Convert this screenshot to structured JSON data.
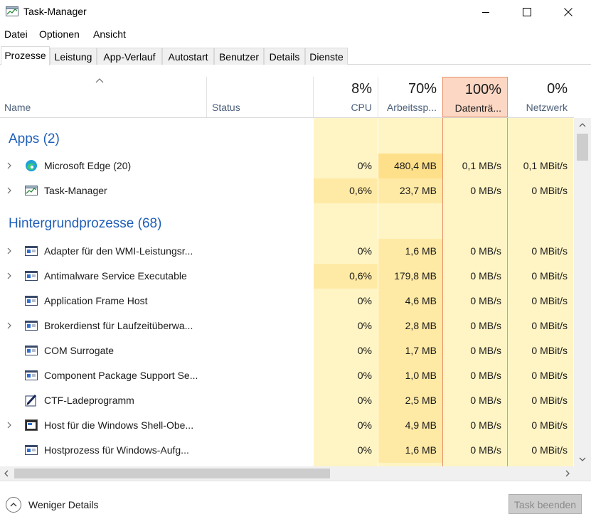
{
  "window": {
    "title": "Task-Manager"
  },
  "menu": [
    "Datei",
    "Optionen",
    "Ansicht"
  ],
  "tabs": [
    "Prozesse",
    "Leistung",
    "App-Verlauf",
    "Autostart",
    "Benutzer",
    "Details",
    "Dienste"
  ],
  "header": {
    "name": "Name",
    "status": "Status",
    "cpu": {
      "pct": "8%",
      "label": "CPU"
    },
    "mem": {
      "pct": "70%",
      "label": "Arbeitssp..."
    },
    "disk": {
      "pct": "100%",
      "label": "Datenträ..."
    },
    "net": {
      "pct": "0%",
      "label": "Netzwerk"
    }
  },
  "groups": {
    "apps": "Apps (2)",
    "bg": "Hintergrundprozesse (68)"
  },
  "apps": [
    {
      "name": "Microsoft Edge (20)",
      "icon": "edge-icon",
      "cpu": "0%",
      "mem": "480,4 MB",
      "disk": "0,1 MB/s",
      "net": "0,1 MBit/s"
    },
    {
      "name": "Task-Manager",
      "icon": "task-manager-icon",
      "cpu": "0,6%",
      "mem": "23,7 MB",
      "disk": "0 MB/s",
      "net": "0 MBit/s"
    }
  ],
  "processes": [
    {
      "name": "Adapter für den WMI-Leistungsr...",
      "expand": true,
      "icon": "process-window-icon",
      "cpu": "0%",
      "mem": "1,6 MB",
      "disk": "0 MB/s",
      "net": "0 MBit/s"
    },
    {
      "name": "Antimalware Service Executable",
      "expand": true,
      "icon": "process-window-icon",
      "cpu": "0,6%",
      "mem": "179,8 MB",
      "disk": "0 MB/s",
      "net": "0 MBit/s"
    },
    {
      "name": "Application Frame Host",
      "expand": false,
      "icon": "process-window-icon",
      "cpu": "0%",
      "mem": "4,6 MB",
      "disk": "0 MB/s",
      "net": "0 MBit/s"
    },
    {
      "name": "Brokerdienst für Laufzeitüberwa...",
      "expand": true,
      "icon": "process-window-icon",
      "cpu": "0%",
      "mem": "2,8 MB",
      "disk": "0 MB/s",
      "net": "0 MBit/s"
    },
    {
      "name": "COM Surrogate",
      "expand": false,
      "icon": "process-window-icon",
      "cpu": "0%",
      "mem": "1,7 MB",
      "disk": "0 MB/s",
      "net": "0 MBit/s"
    },
    {
      "name": "Component Package Support Se...",
      "expand": false,
      "icon": "process-window-icon",
      "cpu": "0%",
      "mem": "1,0 MB",
      "disk": "0 MB/s",
      "net": "0 MBit/s"
    },
    {
      "name": "CTF-Ladeprogramm",
      "expand": false,
      "icon": "ctf-pen-icon",
      "cpu": "0%",
      "mem": "2,5 MB",
      "disk": "0 MB/s",
      "net": "0 MBit/s"
    },
    {
      "name": "Host für die Windows Shell-Obe...",
      "expand": true,
      "icon": "shell-host-icon",
      "cpu": "0%",
      "mem": "4,9 MB",
      "disk": "0 MB/s",
      "net": "0 MBit/s"
    },
    {
      "name": "Hostprozess für Windows-Aufg...",
      "expand": false,
      "icon": "process-window-icon",
      "cpu": "0%",
      "mem": "1,6 MB",
      "disk": "0 MB/s",
      "net": "0 MBit/s"
    }
  ],
  "footer": {
    "less": "Weniger Details",
    "end": "Task beenden"
  },
  "colors": {
    "heat_light": "#fff4c4",
    "heat_mid": "#ffeaa5",
    "heat_strong": "#ffe08a",
    "disk_header": "#fbd7c4",
    "group_blue": "#1f5fb8"
  }
}
